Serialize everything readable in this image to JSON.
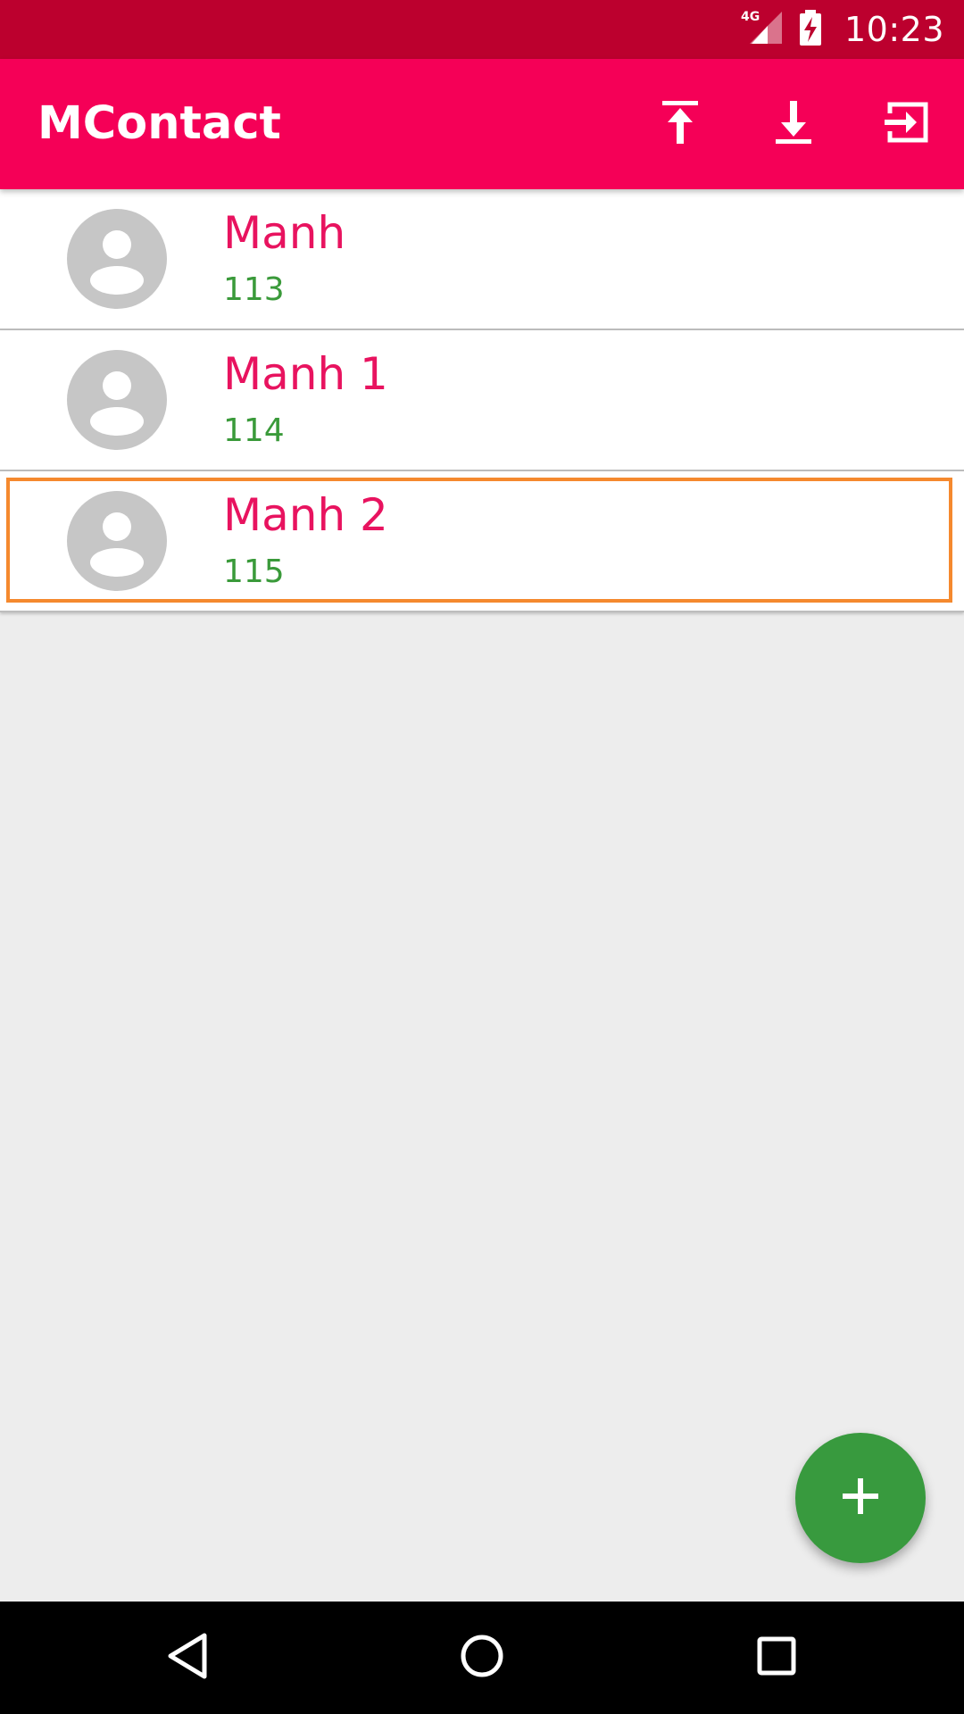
{
  "status_bar": {
    "network": "4G",
    "time": "10:23",
    "icons": [
      "signal-4g-icon",
      "battery-charging-icon"
    ]
  },
  "app_bar": {
    "title": "MContact",
    "actions": [
      {
        "name": "upload-icon",
        "label": "Upload"
      },
      {
        "name": "download-icon",
        "label": "Download"
      },
      {
        "name": "logout-icon",
        "label": "Exit"
      }
    ]
  },
  "contacts": [
    {
      "name": "Manh",
      "phone": "113",
      "avatar": "person-icon"
    },
    {
      "name": "Manh 1",
      "phone": "114",
      "avatar": "person-icon"
    },
    {
      "name": "Manh 2",
      "phone": "115",
      "avatar": "person-icon",
      "selected": true
    }
  ],
  "fab": {
    "icon": "add-icon"
  },
  "nav": {
    "buttons": [
      "back-icon",
      "home-icon",
      "recents-icon"
    ]
  },
  "colors": {
    "status_bar": "#bc002e",
    "app_bar": "#f50057",
    "contact_name": "#e8135f",
    "contact_phone": "#3a9a3a",
    "fab": "#389a3e",
    "selection": "#f5892e",
    "background": "#ededed"
  }
}
